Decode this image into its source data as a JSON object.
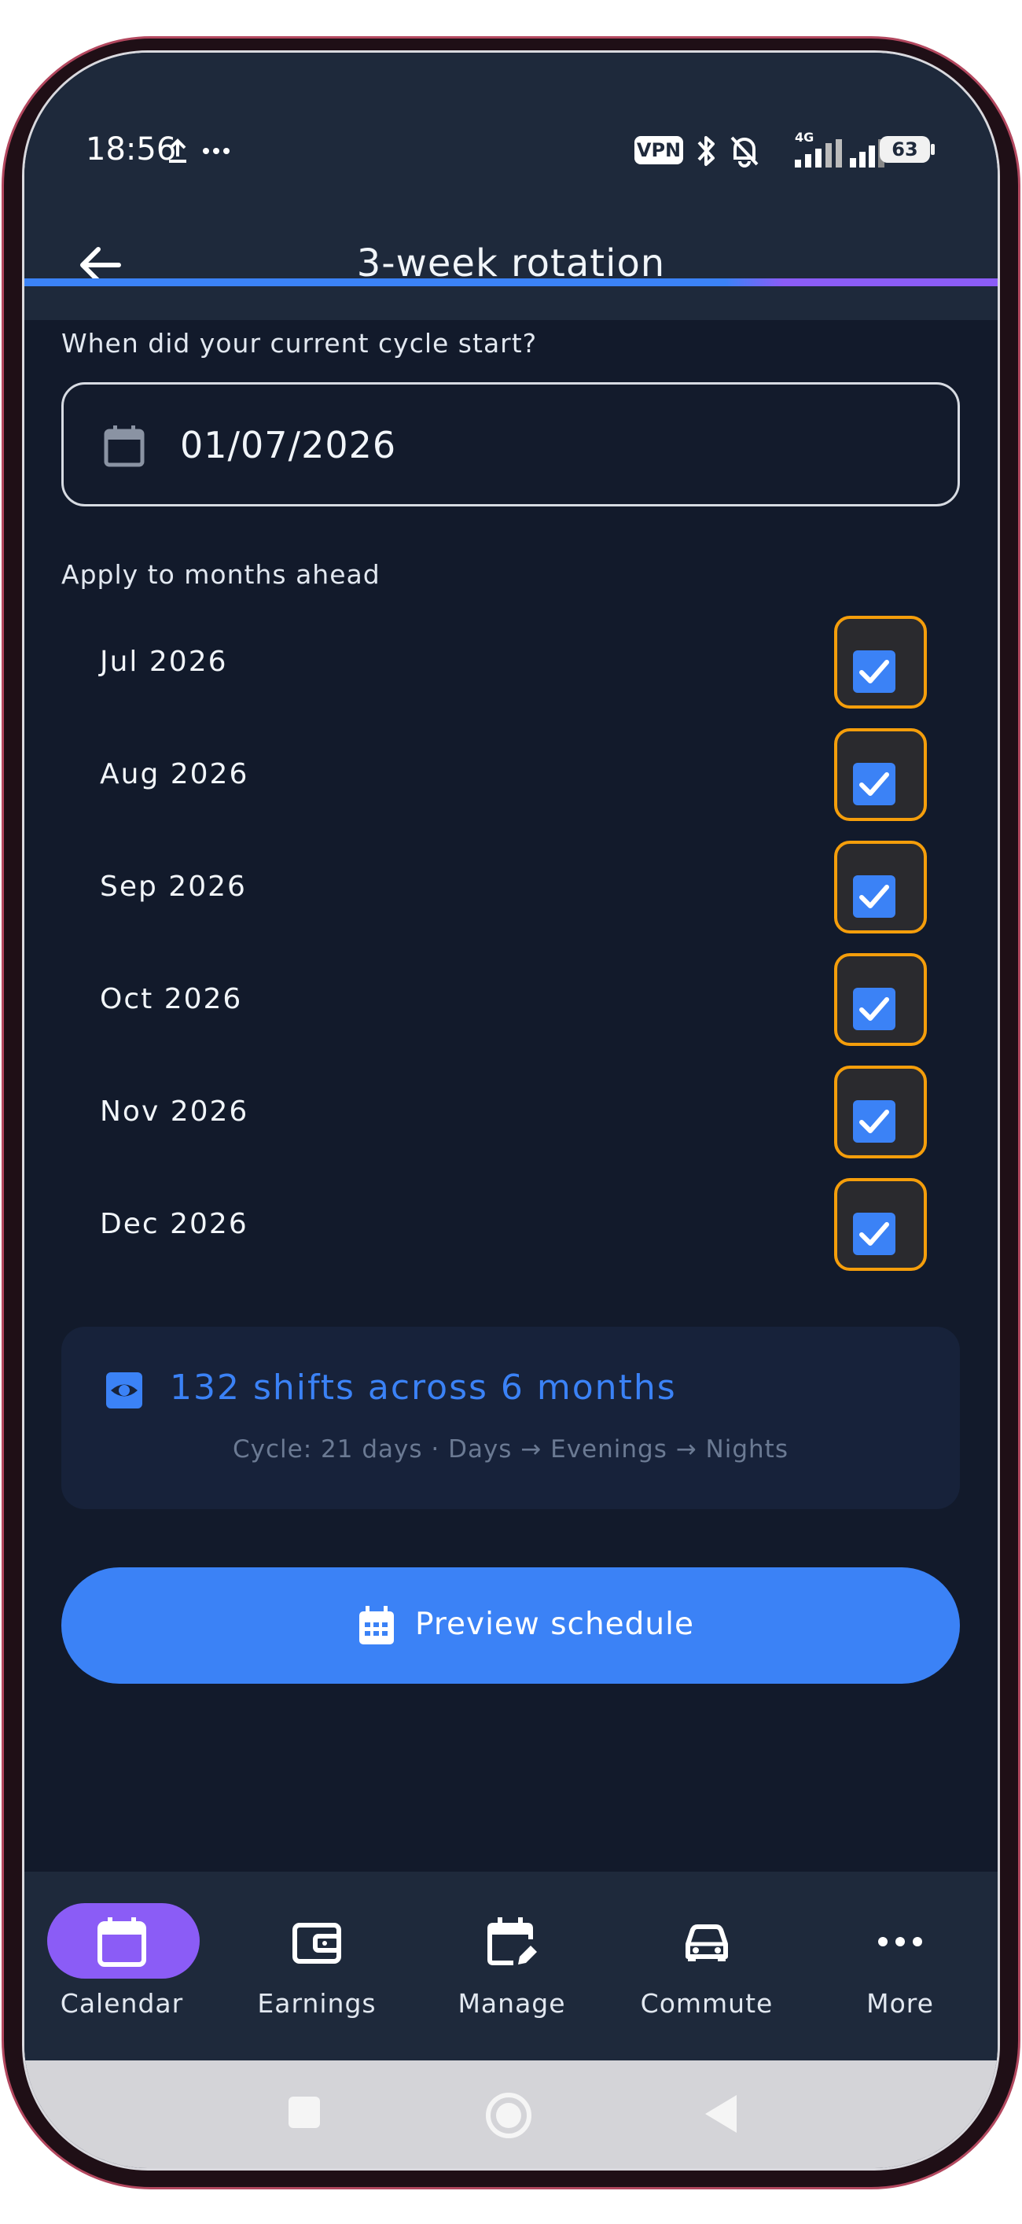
{
  "status_bar": {
    "time": "18:56",
    "vpn": "VPN",
    "network": "4G",
    "battery": "63"
  },
  "header": {
    "title": "3-week rotation"
  },
  "cycle": {
    "question": "When did your current cycle start?",
    "date_value": "01/07/2026"
  },
  "months": {
    "label": "Apply to months ahead",
    "items": [
      {
        "label": "Jul 2026",
        "checked": true
      },
      {
        "label": "Aug 2026",
        "checked": true
      },
      {
        "label": "Sep 2026",
        "checked": true
      },
      {
        "label": "Oct 2026",
        "checked": true
      },
      {
        "label": "Nov 2026",
        "checked": true
      },
      {
        "label": "Dec 2026",
        "checked": true
      }
    ]
  },
  "summary": {
    "title": "132 shifts across 6 months",
    "subtitle": "Cycle: 21 days · Days → Evenings → Nights"
  },
  "preview_button": {
    "label": "Preview schedule"
  },
  "bottom_nav": {
    "items": [
      {
        "label": "Calendar",
        "icon": "calendar-icon",
        "active": true
      },
      {
        "label": "Earnings",
        "icon": "wallet-icon",
        "active": false
      },
      {
        "label": "Manage",
        "icon": "calendar-edit-icon",
        "active": false
      },
      {
        "label": "Commute",
        "icon": "car-icon",
        "active": false
      },
      {
        "label": "More",
        "icon": "more-icon",
        "active": false
      }
    ]
  },
  "colors": {
    "accent": "#3b82f6",
    "active_pill": "#8b5cf6",
    "checkbox_focus": "#f59e0b",
    "background": "#121a2b"
  }
}
